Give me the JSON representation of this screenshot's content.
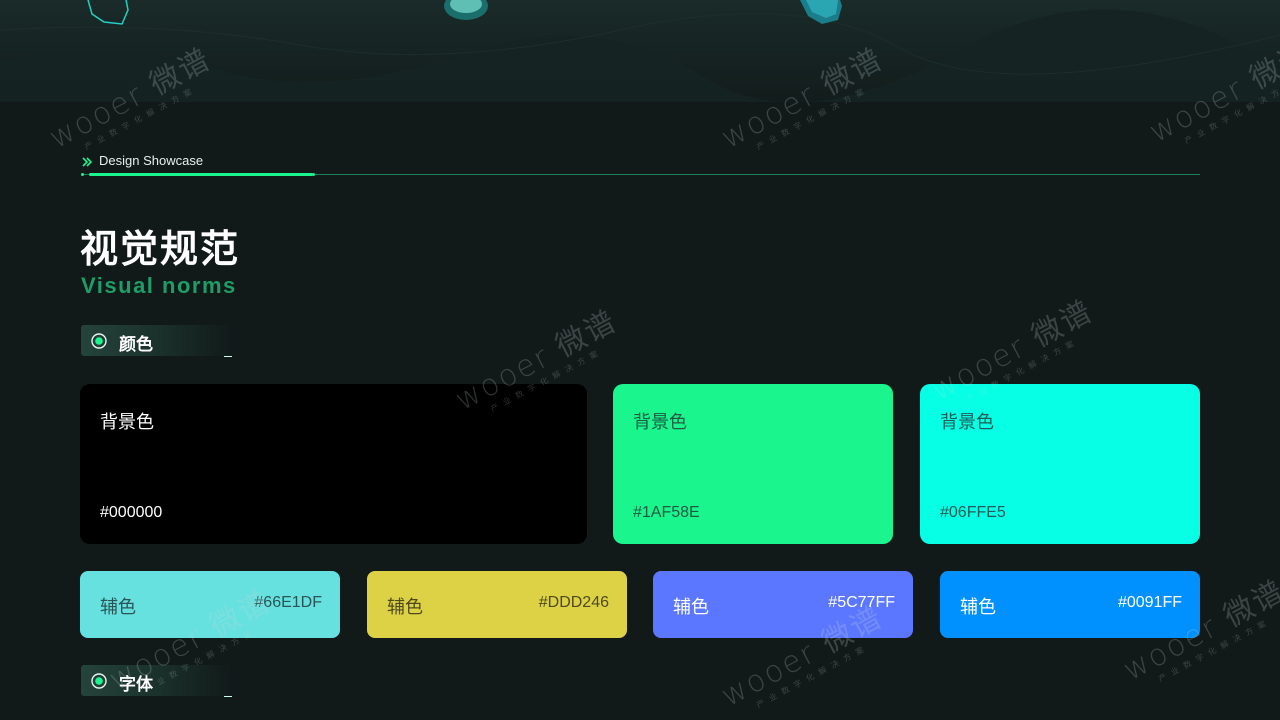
{
  "section": {
    "label": "Design Showcase"
  },
  "title": {
    "cn": "视觉规范",
    "en": "Visual norms"
  },
  "tags": {
    "color": "颜色",
    "font": "字体"
  },
  "primary_colors": [
    {
      "name": "背景色",
      "hex": "#000000",
      "fill": "#000000",
      "text_color": "#ffffff"
    },
    {
      "name": "背景色",
      "hex": "#1AF58E",
      "fill": "#1af58e",
      "text_color": "#1f5a41"
    },
    {
      "name": "背景色",
      "hex": "#06FFE5",
      "fill": "#06ffe5",
      "text_color": "#1e5c57"
    }
  ],
  "accent_colors": [
    {
      "name": "辅色",
      "hex": "#66E1DF",
      "fill": "#66e1df",
      "text_color": "#2a5554"
    },
    {
      "name": "辅色",
      "hex": "#DDD246",
      "fill": "#ddd246",
      "text_color": "#4e4a1c"
    },
    {
      "name": "辅色",
      "hex": "#5C77FF",
      "fill": "#5c77ff",
      "text_color": "#ffffff"
    },
    {
      "name": "辅色",
      "hex": "#0091FF",
      "fill": "#0091ff",
      "text_color": "#ffffff"
    }
  ],
  "watermark": {
    "main": "wooer 微谱",
    "sub": "产业数字化解决方案"
  },
  "colors": {
    "background": "#111a19",
    "brand_green": "#1af58e",
    "subtitle_green": "#1f9d67"
  }
}
